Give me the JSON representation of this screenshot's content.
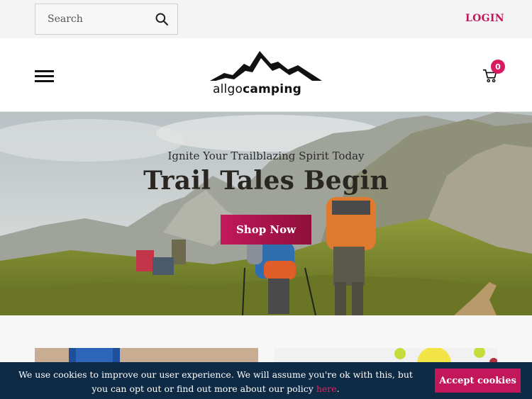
{
  "topbar": {
    "search_placeholder": "Search",
    "login_label": "LOGIN"
  },
  "header": {
    "logo_text_light": "allgo",
    "logo_text_bold": "camping",
    "cart_count": "0"
  },
  "hero": {
    "subtitle": "Ignite Your Trailblazing Spirit Today",
    "title": "Trail Tales Begin",
    "cta_label": "Shop Now"
  },
  "cookie": {
    "message": "We use cookies to improve our user experience. We will assume you're ok with this, but you can opt out or find out more about our policy",
    "link_label": "here",
    "suffix": ".",
    "accept_label": "Accept cookies"
  },
  "colors": {
    "accent": "#c2185b",
    "cookie_bg": "#0f2a44"
  }
}
